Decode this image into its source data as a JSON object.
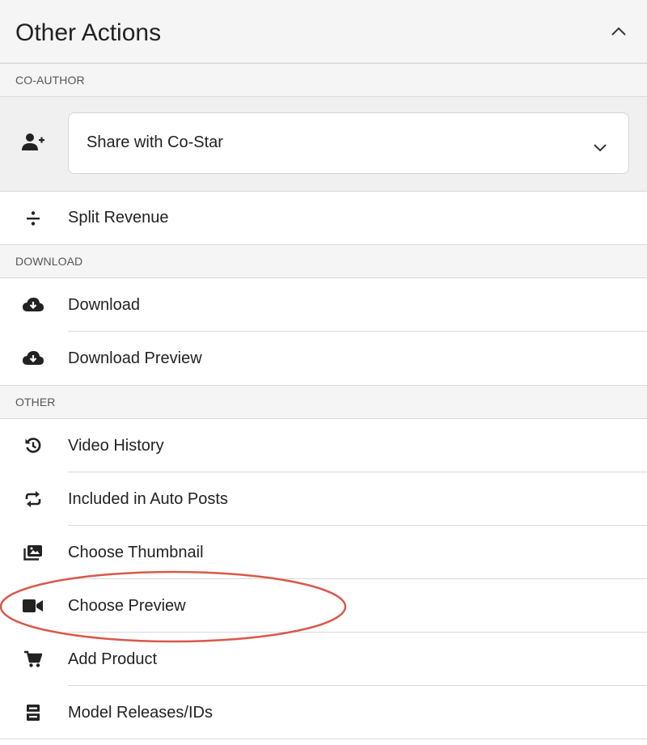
{
  "header": {
    "title": "Other Actions"
  },
  "sections": {
    "coauthor": "CO-AUTHOR",
    "download": "DOWNLOAD",
    "other": "OTHER"
  },
  "coauthor": {
    "select_value": "Share with Co-Star"
  },
  "actions": {
    "split_revenue": "Split Revenue",
    "download": "Download",
    "download_preview": "Download Preview",
    "video_history": "Video History",
    "auto_posts": "Included in Auto Posts",
    "choose_thumbnail": "Choose Thumbnail",
    "choose_preview": "Choose Preview",
    "add_product": "Add Product",
    "model_releases": "Model Releases/IDs"
  },
  "colors": {
    "highlight": "#d9584a",
    "icon": "#222222"
  }
}
